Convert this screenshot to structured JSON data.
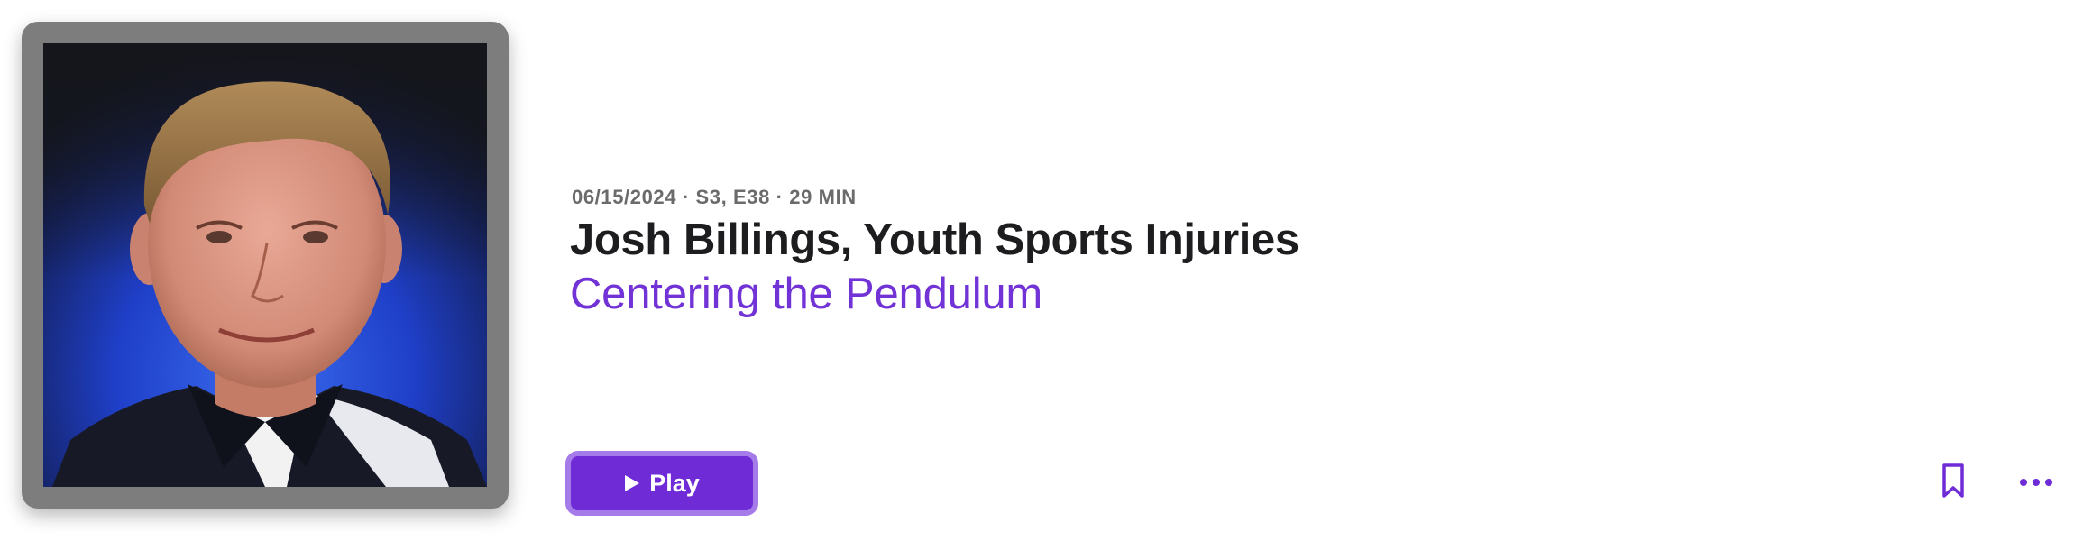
{
  "episode": {
    "meta": "06/15/2024 · S3, E38 · 29 MIN",
    "title": "Josh Billings, Youth Sports Injuries",
    "show_name": "Centering the Pendulum"
  },
  "actions": {
    "play_label": "Play",
    "bookmark_icon": "bookmark-icon",
    "more_icon": "ellipsis-icon"
  },
  "colors": {
    "accent": "#6e2bd6",
    "accent_border": "#a57ae9",
    "title": "#1d1d1f",
    "meta": "#6b6b6b",
    "artwork_frame": "#7d7d7d"
  }
}
